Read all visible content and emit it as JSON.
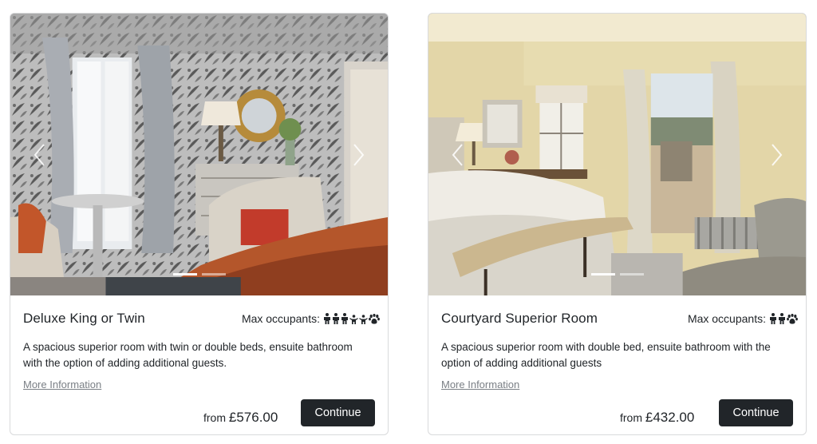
{
  "occupants_label": "Max occupants:",
  "price_prefix": "from",
  "continue_label": "Continue",
  "more_info_label": "More Information",
  "rooms": [
    {
      "title": "Deluxe King or Twin",
      "description": "A spacious superior room with twin or double beds, ensuite bathroom with the option of adding additional guests.",
      "price": "£576.00",
      "occupant_icons": [
        "adult-icon",
        "adult-icon",
        "adult-icon",
        "child-icon",
        "child-icon",
        "pet-icon"
      ],
      "carousel": {
        "slides": 2,
        "active": 0
      }
    },
    {
      "title": "Courtyard Superior Room",
      "description": "A spacious superior room with double bed, ensuite bathroom with the option of adding additional guests",
      "price": "£432.00",
      "occupant_icons": [
        "adult-icon",
        "adult-icon",
        "pet-icon"
      ],
      "carousel": {
        "slides": 2,
        "active": 0
      }
    }
  ]
}
